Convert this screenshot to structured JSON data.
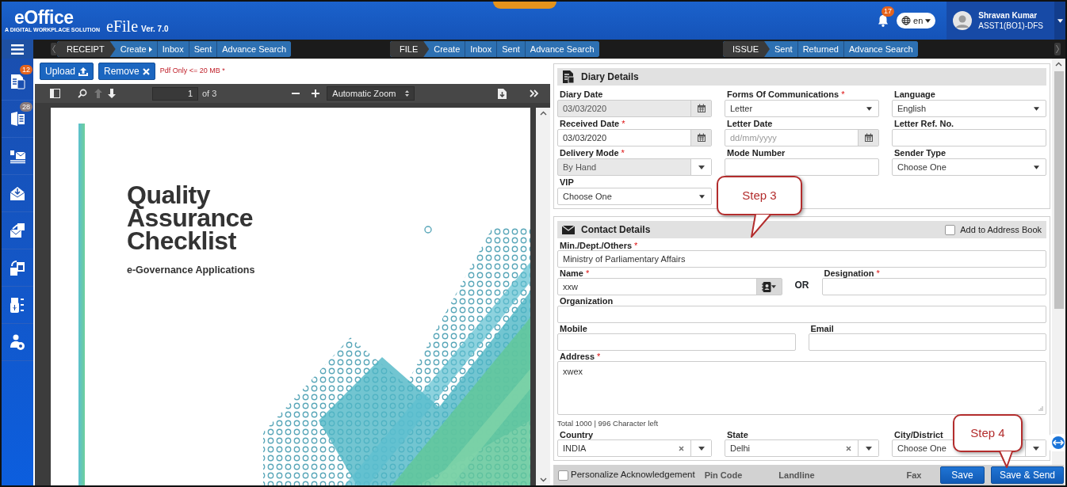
{
  "header": {
    "logo": "eOffice",
    "tagline": "A DIGITAL WORKPLACE SOLUTION",
    "app": "eFile",
    "version": "Ver. 7.0",
    "notifications": "17",
    "language": "en",
    "user_name": "Shravan Kumar",
    "user_role": "ASST1(BO1)-DFS"
  },
  "nav_groups": [
    {
      "title": "RECEIPT",
      "links": [
        {
          "label": "Create",
          "submenu": true
        },
        {
          "label": "Inbox",
          "submenu": false
        },
        {
          "label": "Sent",
          "submenu": false
        },
        {
          "label": "Advance Search",
          "submenu": false
        }
      ]
    },
    {
      "title": "FILE",
      "links": [
        {
          "label": "Create",
          "submenu": false
        },
        {
          "label": "Inbox",
          "submenu": false
        },
        {
          "label": "Sent",
          "submenu": false
        },
        {
          "label": "Advance Search",
          "submenu": false
        }
      ]
    },
    {
      "title": "ISSUE",
      "links": [
        {
          "label": "Sent",
          "submenu": false
        },
        {
          "label": "Returned",
          "submenu": false
        },
        {
          "label": "Advance Search",
          "submenu": false
        }
      ]
    }
  ],
  "sidebar": {
    "badges": [
      "12",
      "28"
    ]
  },
  "upload_bar": {
    "buttons": [
      {
        "label": "Upload",
        "kind": "upload"
      },
      {
        "label": "Remove",
        "kind": "remove"
      }
    ],
    "note": "Pdf Only <= 20 MB *"
  },
  "pdf_viewer": {
    "page": "1",
    "page_count": "of 3",
    "zoom": "Automatic Zoom",
    "previous_disabled": true,
    "document": {
      "title_lines": [
        "Quality",
        "Assurance",
        "Checklist"
      ],
      "subtitle": "e-Governance Applications"
    }
  },
  "diary_details": {
    "title": "Diary Details",
    "rows": [
      [
        {
          "kind": "date",
          "label": "Diary Date",
          "value": "03/03/2020",
          "disabled": true
        },
        {
          "kind": "select",
          "label": "Forms Of Communications",
          "required_mark": "*",
          "value": "Letter",
          "disabled": false
        },
        {
          "kind": "select",
          "label": "Language",
          "value": "English",
          "disabled": false
        }
      ],
      [
        {
          "kind": "date",
          "label": "Received Date",
          "required_mark": "*",
          "value": "03/03/2020",
          "disabled": false
        },
        {
          "kind": "date",
          "label": "Letter Date",
          "placeholder": "dd/mm/yyyy",
          "disabled": false
        },
        {
          "kind": "text",
          "label": "Letter Ref. No.",
          "disabled": false
        }
      ],
      [
        {
          "kind": "combo",
          "label": "Delivery Mode",
          "required_mark": "*",
          "value": "By Hand",
          "disabled": true
        },
        {
          "kind": "text",
          "label": "Mode Number",
          "disabled": false
        },
        {
          "kind": "select",
          "label": "Sender Type",
          "value": "Choose One",
          "disabled": false
        }
      ],
      [
        {
          "kind": "select",
          "label": "VIP",
          "value": "Choose One",
          "disabled": false
        },
        {
          "kind": "blank"
        },
        {
          "kind": "blank"
        }
      ]
    ]
  },
  "contact_details": {
    "title": "Contact Details",
    "address_book": {
      "label": "Add to Address Book",
      "checked": false
    },
    "rows": [
      [
        {
          "kind": "text",
          "label": "Min./Dept./Others",
          "required_mark": "*",
          "value": "Ministry of Parliamentary Affairs",
          "disabled": false
        }
      ],
      [
        {
          "kind": "lookup",
          "label": "Name",
          "required_mark": "*",
          "value": "xxw",
          "disabled": false
        },
        {
          "kind": "separator",
          "text": "OR"
        },
        {
          "kind": "text",
          "label": "Designation",
          "required_mark": "*",
          "disabled": false
        }
      ],
      [
        {
          "kind": "text",
          "label": "Organization",
          "disabled": false
        }
      ],
      [
        {
          "kind": "text",
          "label": "Mobile",
          "disabled": false
        },
        {
          "kind": "text",
          "label": "Email",
          "disabled": false
        }
      ],
      [
        {
          "kind": "textarea",
          "label": "Address",
          "required_mark": "*",
          "value": "xwex",
          "disabled": false
        }
      ],
      [
        {
          "kind": "note",
          "text": "Total 1000 | 996 Character left"
        }
      ],
      [
        {
          "kind": "clearable",
          "label": "Country",
          "value": "INDIA",
          "disabled": false
        },
        {
          "kind": "clearable",
          "label": "State",
          "value": "Delhi",
          "disabled": false
        },
        {
          "kind": "combo",
          "label": "City/District",
          "value": "Choose One",
          "disabled": false
        }
      ]
    ]
  },
  "footer": {
    "checkbox": {
      "label": "Personalize Acknowledgement",
      "checked": false
    },
    "covered_labels": [
      "Pin Code",
      "Landline",
      "Fax"
    ],
    "buttons": [
      {
        "label": "Save"
      },
      {
        "label": "Save & Send"
      }
    ]
  },
  "callouts": [
    {
      "text": "Step 3"
    },
    {
      "text": "Step 4"
    }
  ]
}
